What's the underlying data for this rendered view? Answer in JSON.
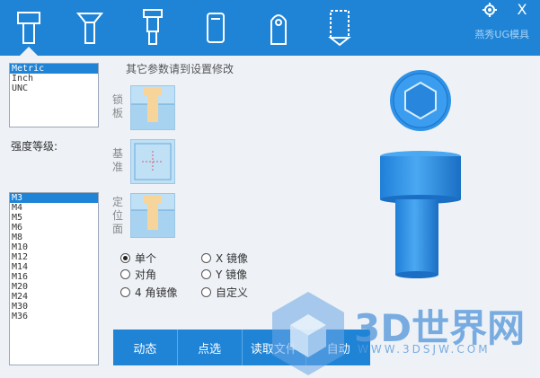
{
  "toolbar": {
    "tabs": [
      {
        "name": "socket-head-screw-icon",
        "active": true
      },
      {
        "name": "countersunk-screw-icon",
        "active": false
      },
      {
        "name": "shoulder-bolt-icon",
        "active": false
      },
      {
        "name": "dowel-pin-icon",
        "active": false
      },
      {
        "name": "pull-pin-icon",
        "active": false
      },
      {
        "name": "threaded-insert-icon",
        "active": false
      }
    ],
    "settings_icon": "gear-icon",
    "close_label": "X",
    "brand": "燕秀UG模具"
  },
  "units_list": {
    "items": [
      "Metric",
      "Inch",
      "UNC"
    ],
    "selected": "Metric"
  },
  "strength_label": "强度等级:",
  "size_list": {
    "items": [
      "M3",
      "M4",
      "M5",
      "M6",
      "M8",
      "M10",
      "M12",
      "M14",
      "M16",
      "M20",
      "M24",
      "M30",
      "M36"
    ],
    "selected": "M3"
  },
  "hint": "其它参数请到设置修改",
  "side_labels": {
    "lock": "锁板",
    "base": "基准",
    "locate": "定位面"
  },
  "radios": {
    "single": "单个",
    "x_mirror": "X 镜像",
    "diagonal": "对角",
    "y_mirror": "Y 镜像",
    "four_mirror": "4 角镜像",
    "custom": "自定义",
    "selected": "single"
  },
  "buttons": {
    "dynamic": "动态",
    "pick": "点选",
    "read_file": "读取文件",
    "auto": "自动"
  },
  "watermark": {
    "text": "3D世界网",
    "url": "WWW.3DSJW.COM"
  },
  "colors": {
    "accent": "#1f84d6",
    "model": "#2b8be0"
  }
}
